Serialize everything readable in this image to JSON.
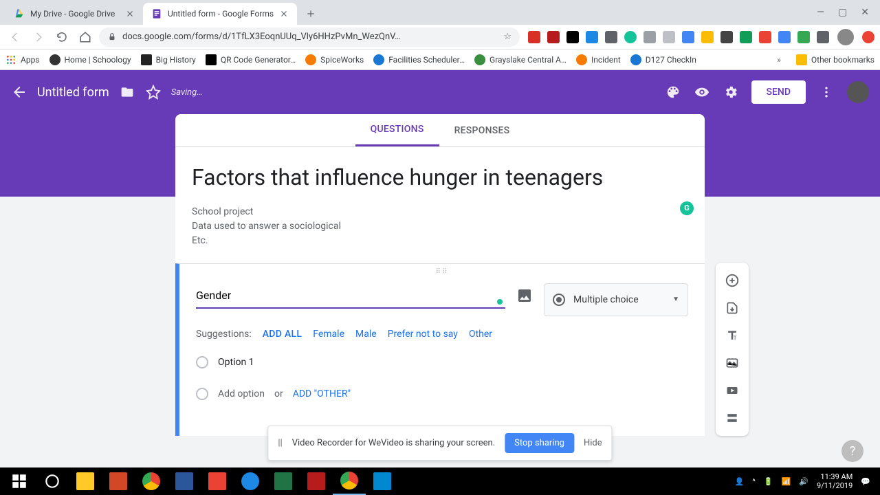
{
  "browser": {
    "tabs": [
      {
        "title": "My Drive - Google Drive",
        "icon_color": "#0f9d58"
      },
      {
        "title": "Untitled form - Google Forms",
        "icon_color": "#673ab7"
      }
    ],
    "url": "docs.google.com/forms/d/1TfLX3EoqnUUq_Vly6HHzPvMn_WezQnV…",
    "bookmarks": [
      "Apps",
      "Home | Schoology",
      "Big History",
      "QR Code Generator…",
      "SpiceWorks",
      "Facilities Scheduler…",
      "Grayslake Central A…",
      "Incident",
      "D127 CheckIn"
    ],
    "other_bookmarks": "Other bookmarks"
  },
  "header": {
    "form_name": "Untitled form",
    "saving": "Saving…",
    "send": "SEND"
  },
  "tabs": {
    "questions": "QUESTIONS",
    "responses": "RESPONSES"
  },
  "title_card": {
    "title": "Factors that influence hunger in teenagers",
    "description": "School project\nData used to answer a sociological\nEtc."
  },
  "question": {
    "text": "Gender",
    "type_label": "Multiple choice",
    "suggestions_label": "Suggestions:",
    "add_all": "ADD ALL",
    "suggestions": [
      "Female",
      "Male",
      "Prefer not to say",
      "Other"
    ],
    "option1": "Option 1",
    "add_option": "Add option",
    "or": "or",
    "add_other": "ADD \"OTHER\""
  },
  "share_notif": {
    "text": "Video Recorder for WeVideo is sharing your screen.",
    "stop": "Stop sharing",
    "hide": "Hide"
  },
  "taskbar": {
    "time": "11:39 AM",
    "date": "9/11/2019"
  },
  "colors": {
    "primary": "#673ab7",
    "accent": "#4285f4",
    "link": "#1a73e8"
  }
}
